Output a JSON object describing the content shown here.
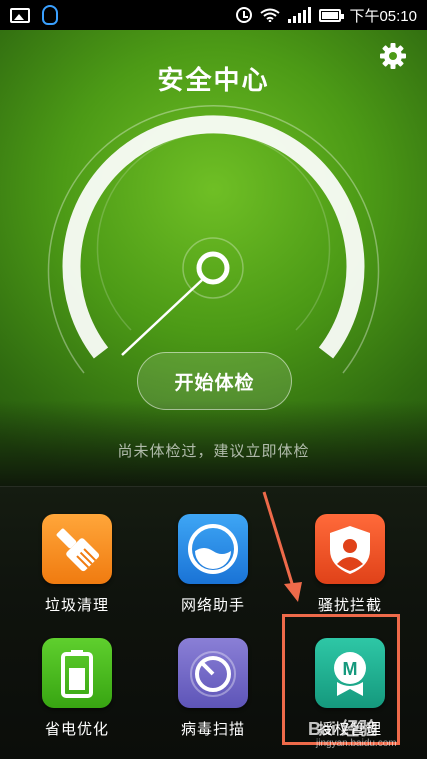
{
  "status_bar": {
    "time": "下午05:10",
    "battery_level": 1.0
  },
  "hero": {
    "title": "安全中心",
    "start_button": "开始体检",
    "hint": "尚未体检过，建议立即体检"
  },
  "tiles": [
    {
      "label": "垃圾清理",
      "icon": "broom-icon"
    },
    {
      "label": "网络助手",
      "icon": "network-icon"
    },
    {
      "label": "骚扰拦截",
      "icon": "shield-person-icon"
    },
    {
      "label": "省电优化",
      "icon": "battery-icon"
    },
    {
      "label": "病毒扫描",
      "icon": "virus-scan-icon"
    },
    {
      "label": "授权管理",
      "icon": "permission-badge-icon"
    }
  ],
  "watermark": {
    "text": "Bai 经验",
    "url": "jingyan.baidu.com"
  },
  "colors": {
    "hero_green": "#4c9a16",
    "annotation": "#ee6a4a"
  }
}
